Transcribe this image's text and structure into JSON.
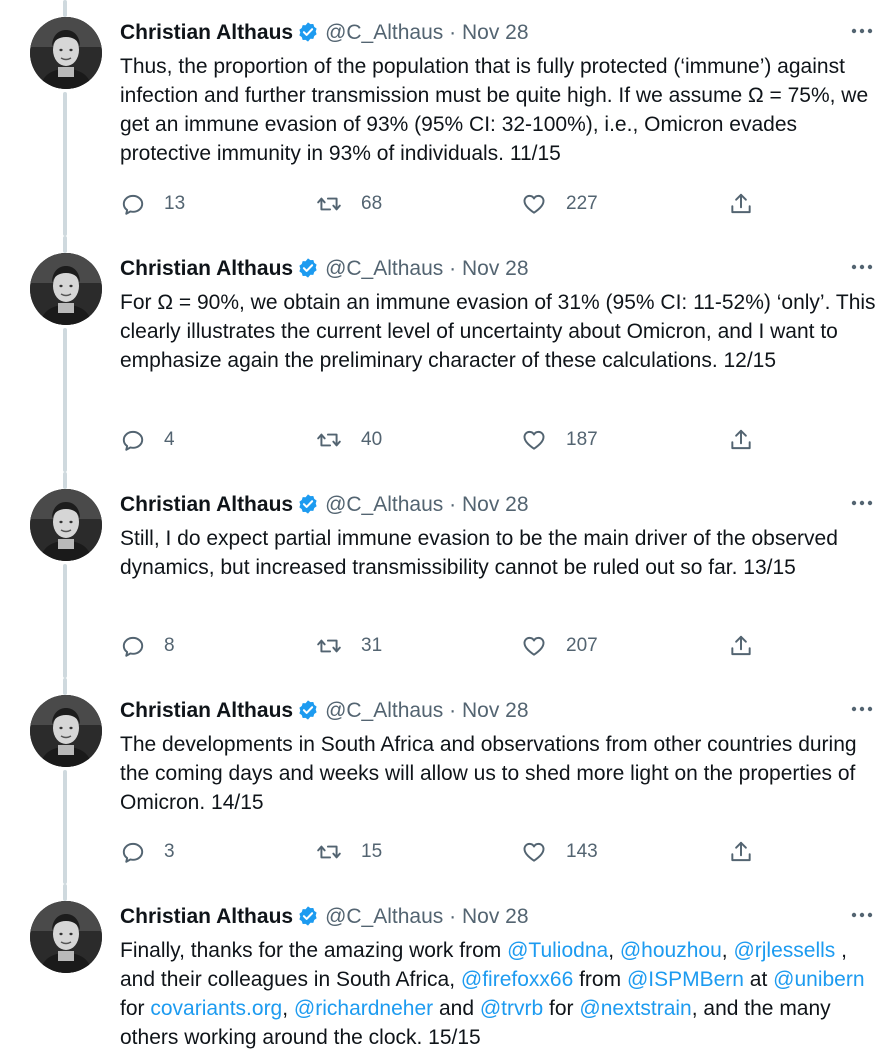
{
  "author": {
    "name": "Christian Althaus",
    "handle": "@C_Althaus",
    "separator": "·",
    "verified": true,
    "avatar": "avatar-photo"
  },
  "colors": {
    "text": "#0f1419",
    "secondary": "#536471",
    "link": "#1d9bf0",
    "verified": "#1d9bf0",
    "thread_line": "#cfd9de"
  },
  "icons": {
    "reply": "reply-icon",
    "retweet": "retweet-icon",
    "like": "heart-icon",
    "share": "share-icon",
    "more": "more-icon",
    "verified": "verified-badge-icon"
  },
  "tweets": [
    {
      "date": "Nov 28",
      "text": "Thus, the proportion of the population that is fully protected (‘immune’) against infection and further transmission must be quite high. If we assume Ω = 75%, we get an immune evasion of 93% (95% CI: 32-100%), i.e., Omicron evades protective immunity in 93% of individuals. 11/15",
      "replies": "13",
      "retweets": "68",
      "likes": "227"
    },
    {
      "date": "Nov 28",
      "text": "For Ω = 90%, we obtain an immune evasion of 31% (95% CI: 11-52%) ‘only’. This clearly illustrates the current level of uncertainty about Omicron, and I want to emphasize again the preliminary character of these calculations. 12/15",
      "replies": "4",
      "retweets": "40",
      "likes": "187"
    },
    {
      "date": "Nov 28",
      "text": "Still, I do expect partial immune evasion to be the main driver of the observed dynamics, but increased transmissibility cannot be ruled out so far. 13/15",
      "replies": "8",
      "retweets": "31",
      "likes": "207"
    },
    {
      "date": "Nov 28",
      "text": "The developments in South Africa and observations from other countries during the coming days and weeks will allow us to shed more light on the properties of Omicron. 14/15",
      "replies": "3",
      "retweets": "15",
      "likes": "143"
    },
    {
      "date": "Nov 28",
      "segments": [
        {
          "type": "text",
          "value": "Finally, thanks for the amazing work from "
        },
        {
          "type": "link",
          "value": "@Tuliodna"
        },
        {
          "type": "text",
          "value": ", "
        },
        {
          "type": "link",
          "value": "@houzhou"
        },
        {
          "type": "text",
          "value": ", "
        },
        {
          "type": "link",
          "value": "@rjlessells"
        },
        {
          "type": "text",
          "value": " , and their colleagues in South Africa, "
        },
        {
          "type": "link",
          "value": "@firefoxx66"
        },
        {
          "type": "text",
          "value": " from "
        },
        {
          "type": "link",
          "value": "@ISPMBern"
        },
        {
          "type": "text",
          "value": " at "
        },
        {
          "type": "link",
          "value": "@unibern"
        },
        {
          "type": "text",
          "value": " for "
        },
        {
          "type": "link",
          "value": "covariants.org"
        },
        {
          "type": "text",
          "value": ", "
        },
        {
          "type": "link",
          "value": "@richardneher"
        },
        {
          "type": "text",
          "value": " and "
        },
        {
          "type": "link",
          "value": "@trvrb"
        },
        {
          "type": "text",
          "value": " for "
        },
        {
          "type": "link",
          "value": "@nextstrain"
        },
        {
          "type": "text",
          "value": ", and the many others working around the clock. 15/15"
        }
      ]
    }
  ]
}
